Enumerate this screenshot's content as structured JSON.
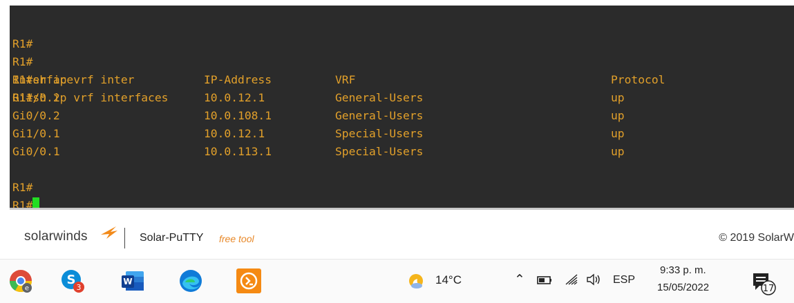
{
  "terminal": {
    "lines_before": [
      "R1#",
      "R1#",
      "R1#sh ip vrf inter",
      "R1#sh ip vrf interfaces"
    ],
    "table": {
      "headers": [
        "Interface",
        "IP-Address",
        "VRF",
        "Protocol"
      ],
      "rows": [
        [
          "Gi1/0.2",
          "10.0.12.1",
          "General-Users",
          "up"
        ],
        [
          "Gi0/0.2",
          "10.0.108.1",
          "General-Users",
          "up"
        ],
        [
          "Gi1/0.1",
          "10.0.12.1",
          "Special-Users",
          "up"
        ],
        [
          "Gi0/0.1",
          "10.0.113.1",
          "Special-Users",
          "up"
        ]
      ]
    },
    "lines_after": [
      "R1#",
      "R1#"
    ],
    "text_color": "#e2a02a",
    "cursor_color": "#22dd22",
    "background": "#2b2b2b"
  },
  "brand": {
    "logo_text": "solarwinds",
    "product_name": "Solar-PuTTY",
    "product_tag": "free tool",
    "copyright": "© 2019 SolarW"
  },
  "taskbar": {
    "apps": [
      {
        "icon": "chrome-icon"
      },
      {
        "icon": "skype-icon",
        "badge": "3"
      },
      {
        "icon": "word-icon"
      },
      {
        "icon": "edge-icon"
      },
      {
        "icon": "solar-putty-icon"
      }
    ],
    "weather": {
      "icon": "weather-partly-cloudy-icon",
      "temp": "14°C"
    },
    "tray_icons": [
      "chevron-up-icon",
      "battery-icon",
      "wifi-icon",
      "speaker-icon"
    ],
    "language": "ESP",
    "time": "9:33 p. m.",
    "date": "15/05/2022",
    "notifications_count": "17"
  }
}
